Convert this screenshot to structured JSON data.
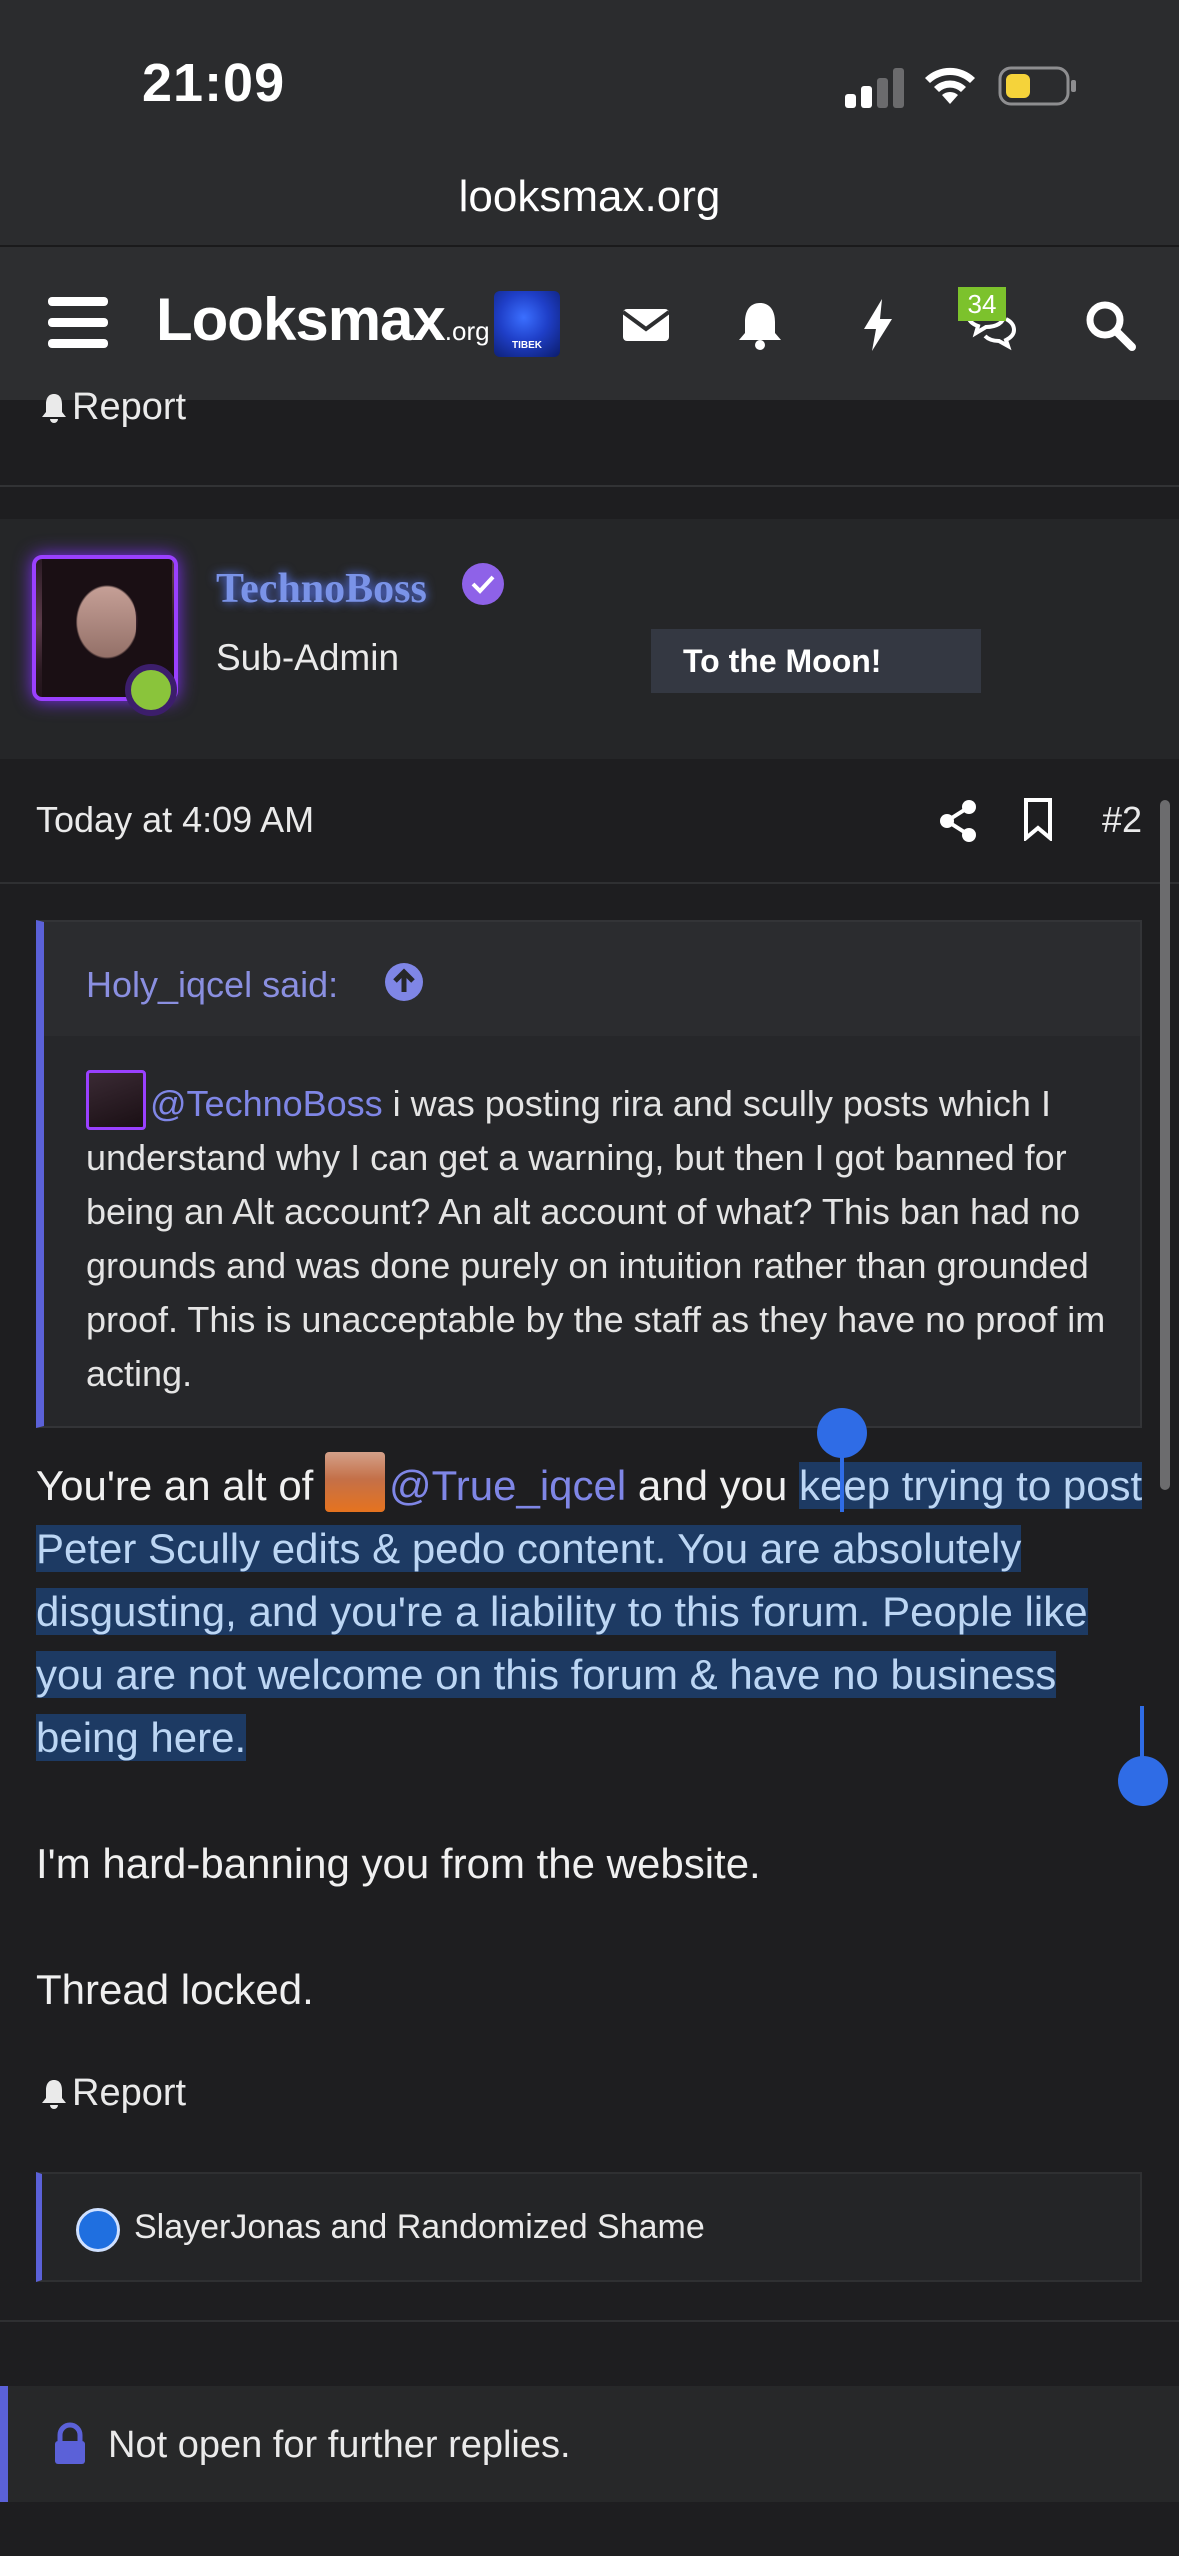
{
  "status_bar": {
    "time": "21:09"
  },
  "browser": {
    "url": "looksmax.org"
  },
  "header": {
    "logo_main": "Looksmax",
    "logo_suffix": ".org",
    "avatar_caption": "TIBEK",
    "conversations_badge": "34"
  },
  "prev_post": {
    "report_label": "Report"
  },
  "post": {
    "username": "TechnoBoss",
    "user_title": "Sub-Admin",
    "banner": "To the Moon!",
    "date": "Today at 4:09 AM",
    "post_number": "#2",
    "quote": {
      "author": "Holy_iqcel said:",
      "mention": "@TechnoBoss",
      "text": " i was posting rira and scully posts which I understand why I can get a warning, but then I got banned for being an Alt account? An alt account of what? This ban had no grounds and was done purely on intuition rather than grounded proof. This is unacceptable by the staff as they have no proof im acting."
    },
    "body": {
      "p1_start": "You're an alt of ",
      "p1_mention": "@True_iqcel",
      "p1_mid": " and you ",
      "p1_selected": "keep trying to post Peter Scully edits & pedo content. You are absolutely disgusting, and you're a liability to this forum. People like you are not welcome on this forum & have no business being here.",
      "p2": "I'm hard-banning you from the website.",
      "p3": "Thread locked."
    },
    "report_label": "Report",
    "reactions": "SlayerJonas and Randomized Shame"
  },
  "thread_status": "Not open for further replies.",
  "colors": {
    "accent": "#5b61d8",
    "selection": "#1d3a63",
    "handle": "#2f6ce6",
    "online": "#8ac43b",
    "username": "#7a93e8"
  }
}
